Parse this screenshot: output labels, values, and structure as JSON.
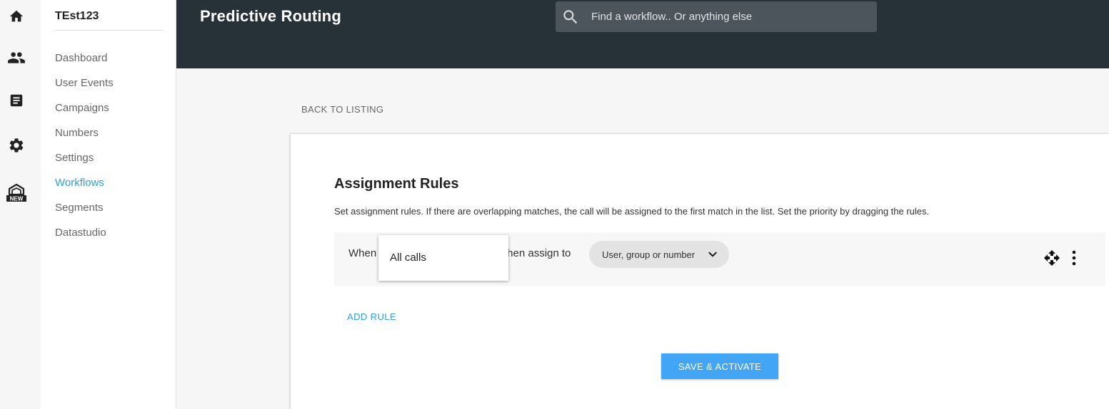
{
  "rail": {
    "icons": [
      "home-icon",
      "users-icon",
      "document-icon",
      "gear-icon",
      "new-feature-icon"
    ],
    "new_badge": "NEW"
  },
  "sidebar": {
    "org_name": "TEst123",
    "items": [
      {
        "label": "Dashboard"
      },
      {
        "label": "User Events"
      },
      {
        "label": "Campaigns"
      },
      {
        "label": "Numbers"
      },
      {
        "label": "Settings"
      },
      {
        "label": "Workflows",
        "active": true
      },
      {
        "label": "Segments"
      },
      {
        "label": "Datastudio"
      }
    ]
  },
  "header": {
    "title": "Predictive Routing",
    "search_placeholder": "Find a workflow.. Or anything else"
  },
  "content": {
    "back_label": "BACK TO LISTING",
    "card_title": "Assignment Rules",
    "card_desc": "Set assignment rules. If there are overlapping matches, the call will be assigned to the first match in the list. Set the priority by dragging the rules.",
    "rule": {
      "when_label": "When",
      "then_label": "then assign to",
      "assignee_placeholder": "User, group or number"
    },
    "dropdown_options": [
      "All calls"
    ],
    "add_rule_label": "ADD RULE",
    "save_label": "SAVE & ACTIVATE"
  },
  "colors": {
    "header_bg": "#263238",
    "accent": "#2e9fd8",
    "button": "#42a5f5"
  }
}
